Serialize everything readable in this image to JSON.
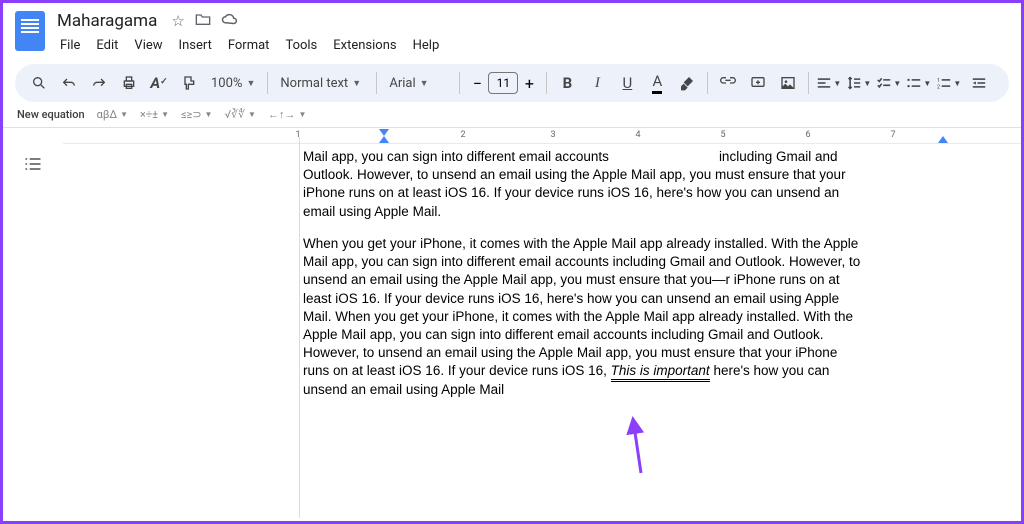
{
  "header": {
    "title": "Maharagama",
    "icons": {
      "star": "☆",
      "move": "🗀",
      "cloud": "☁"
    }
  },
  "menu": {
    "file": "File",
    "edit": "Edit",
    "view": "View",
    "insert": "Insert",
    "format": "Format",
    "tools": "Tools",
    "extensions": "Extensions",
    "help": "Help"
  },
  "toolbar": {
    "zoom": "100%",
    "style": "Normal text",
    "font": "Arial",
    "fontSize": "11",
    "minus": "−",
    "plus": "+"
  },
  "equationBar": {
    "label": "New equation",
    "g1": "αβΔ",
    "g2": "×÷±",
    "g3": "≤≥⊃",
    "g4": "√∛∜",
    "g5": "←↑→"
  },
  "ruler": {
    "marks": [
      "1",
      "2",
      "3",
      "4",
      "5",
      "6",
      "7"
    ]
  },
  "document": {
    "p1a": "Mail app, you can sign into different email accounts",
    "p1b": "including Gmail and Outlook. However, to unsend an email using the Apple Mail app, you must ensure that your iPhone runs on at least iOS 16. If your device runs iOS 16, here's how you can unsend an email using Apple Mail.",
    "p2a": "When you get your iPhone, it comes with the Apple Mail app already installed. With the Apple Mail app, you can sign into different email accounts including Gmail and Outlook. However, to unsend an email using the Apple Mail app, you must ensure that you—r iPhone runs on at least iOS 16. If your device runs iOS 16, here's how you can unsend an email using Apple Mail. When you get your iPhone, it comes with the Apple Mail app already installed. With the Apple Mail app, you can sign into different email accounts including Gmail and Outlook. However, to unsend an email using the Apple Mail app, you must ensure that your iPhone runs on at least iOS 16. If your device runs iOS 16, ",
    "p2italic": "This is important",
    "p2b": " here's how you can unsend an email using Apple Mail"
  }
}
